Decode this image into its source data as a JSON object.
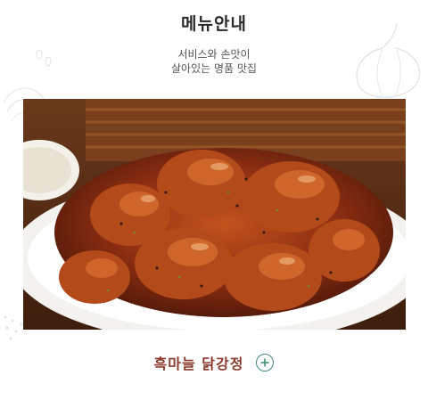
{
  "header": {
    "title": "메뉴안내",
    "subtitle_line1": "서비스와 손맛이",
    "subtitle_line2": "살아있는 명품 맛집"
  },
  "menu_item": {
    "name": "흑마늘 닭강정",
    "more_icon": "plus-circle-icon",
    "image_icon": "fried-chicken-photo"
  },
  "colors": {
    "title": "#2a2a2a",
    "menu_name": "#8a3a2c",
    "plus_accent": "#3f8f6a"
  }
}
